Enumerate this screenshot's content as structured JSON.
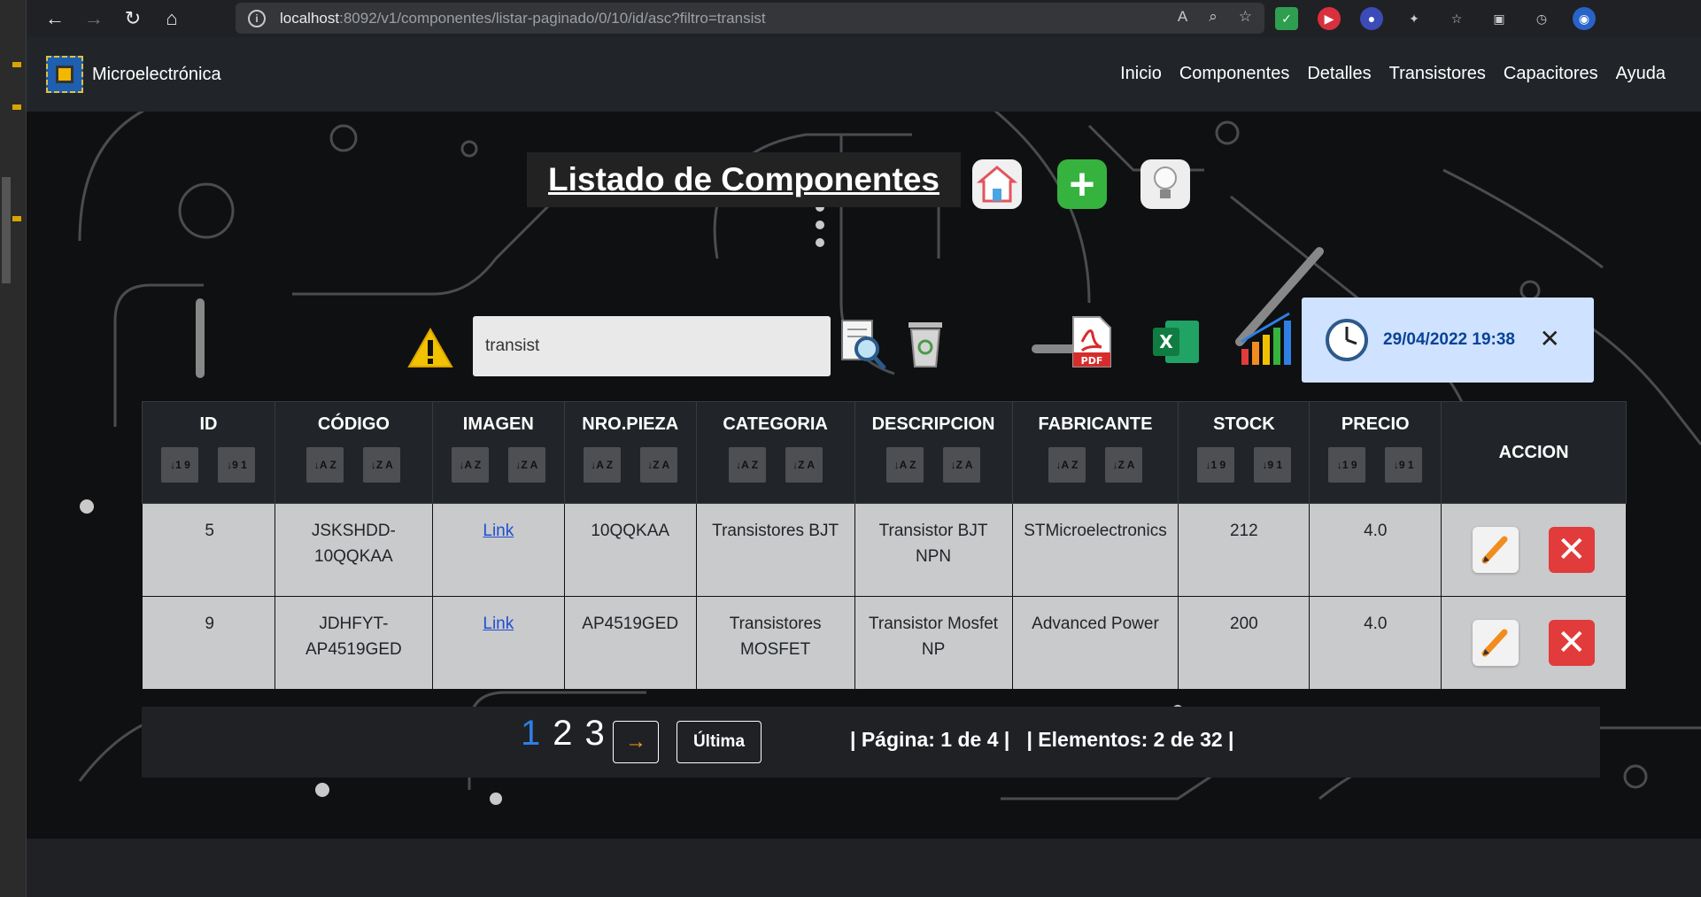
{
  "browser": {
    "url_host": "localhost",
    "url_path": ":8092/v1/componentes/listar-paginado/0/10/id/asc?filtro=transist"
  },
  "navbar": {
    "brand": "Microelectrónica",
    "items": [
      {
        "label": "Inicio"
      },
      {
        "label": "Componentes"
      },
      {
        "label": "Detalles"
      },
      {
        "label": "Transistores"
      },
      {
        "label": "Capacitores"
      },
      {
        "label": "Ayuda"
      }
    ]
  },
  "page_title": "Listado de Componentes",
  "search": {
    "value": "transist"
  },
  "datetime": "29/04/2022 19:38",
  "table": {
    "headers": [
      "ID",
      "CÓDIGO",
      "IMAGEN",
      "NRO.PIEZA",
      "CATEGORIA",
      "DESCRIPCION",
      "FABRICANTE",
      "STOCK",
      "PRECIO",
      "ACCION"
    ],
    "rows": [
      {
        "id": "5",
        "codigo": "JSKSHDD-10QQKAA",
        "imagen": "Link",
        "nro_pieza": "10QQKAA",
        "categoria": "Transistores BJT",
        "descripcion": "Transistor BJT NPN",
        "fabricante": "STMicroelectronics",
        "stock": "212",
        "precio": "4.0"
      },
      {
        "id": "9",
        "codigo": "JDHFYT-AP4519GED",
        "imagen": "Link",
        "nro_pieza": "AP4519GED",
        "categoria": "Transistores MOSFET",
        "descripcion": "Transistor Mosfet NP",
        "fabricante": "Advanced Power",
        "stock": "200",
        "precio": "4.0"
      }
    ]
  },
  "pagination": {
    "pages": [
      "1",
      "2",
      "3"
    ],
    "next_label": "→",
    "last_label": "Última",
    "info": "| Página: 1 de 4 |   | Elementos: 2 de 32 |"
  },
  "colors": {
    "accent": "#2f7fe5",
    "nav_bg": "#212529",
    "alert_bg": "#cfe2ff",
    "alert_text": "#084298"
  }
}
